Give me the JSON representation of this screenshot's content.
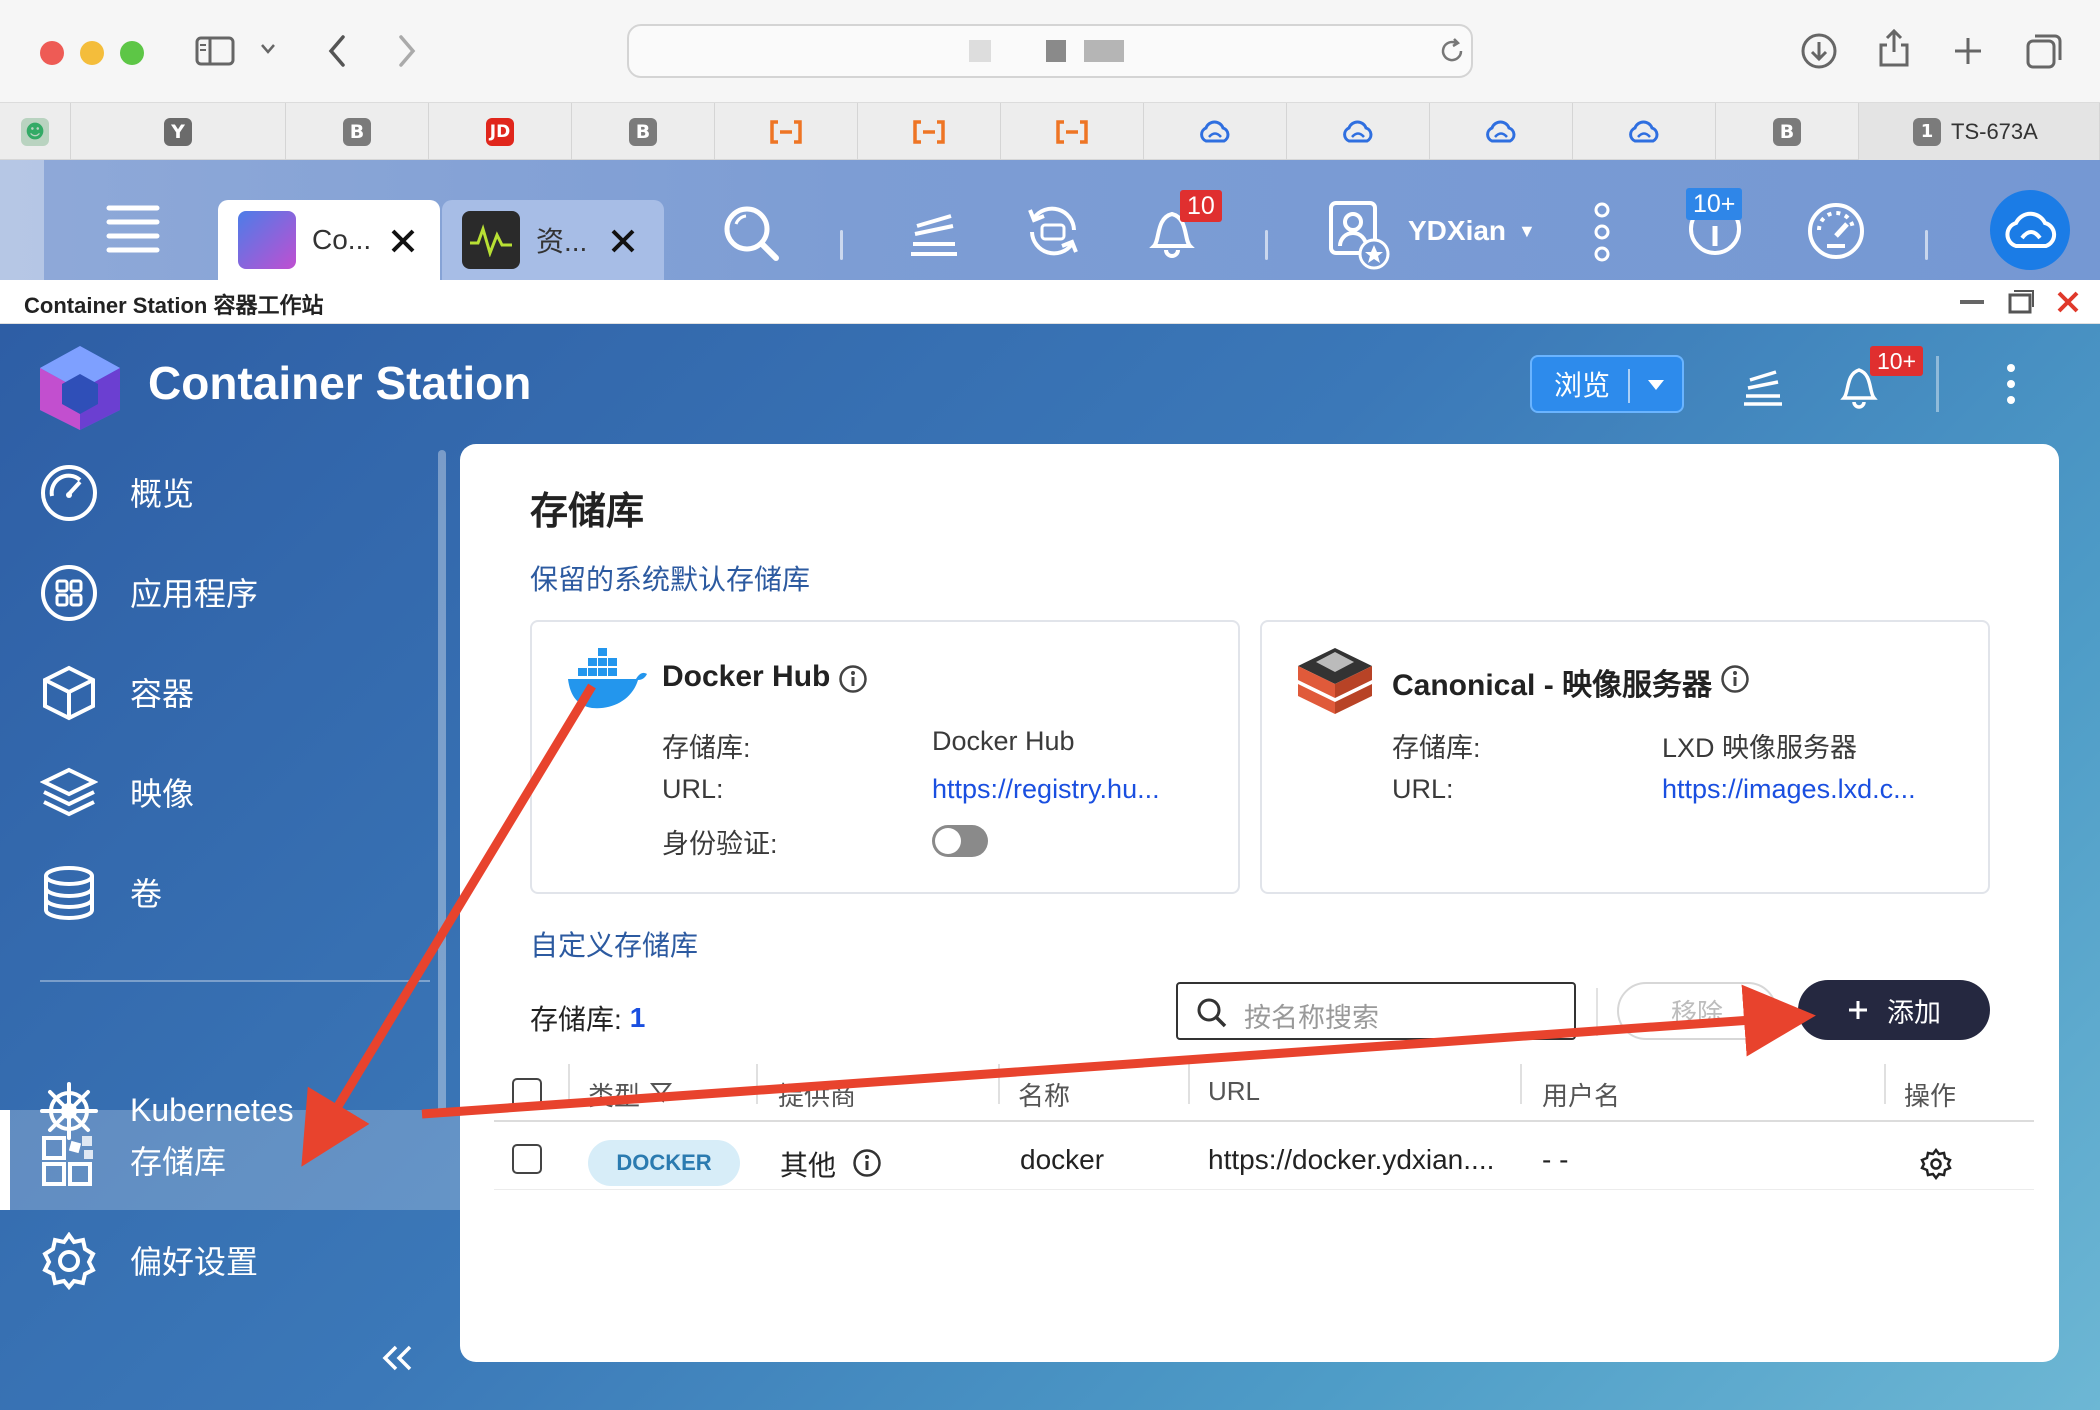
{
  "browser": {
    "favorites": [
      "",
      "Y",
      "B",
      "JD",
      "B",
      "",
      "",
      "",
      "",
      "",
      "",
      "",
      "B"
    ],
    "active_tab_badge": "1",
    "active_tab_label": "TS-673A",
    "colors": {
      "yahoo": "#6b6b6b",
      "bilibili": "#7b7b7b",
      "jd": "#e0261c",
      "orange": "#ee7524",
      "cloud": "#2f6fe0"
    }
  },
  "qts": {
    "tabs": [
      {
        "label": "Co...",
        "icon": "container-station-icon"
      },
      {
        "label": "资...",
        "icon": "resource-monitor-icon"
      }
    ],
    "notification_count": "10",
    "user": "YDXian",
    "update_badge": "10+"
  },
  "window": {
    "title": "Container Station 容器工作站"
  },
  "app": {
    "name": "Container Station",
    "browse_label": "浏览",
    "notification_badge": "10+"
  },
  "sidebar": {
    "items": [
      {
        "label": "概览",
        "icon": "dashboard-icon"
      },
      {
        "label": "应用程序",
        "icon": "apps-icon"
      },
      {
        "label": "容器",
        "icon": "container-cube-icon"
      },
      {
        "label": "映像",
        "icon": "layers-icon"
      },
      {
        "label": "卷",
        "icon": "database-icon"
      },
      {
        "label": "Kubernetes",
        "icon": "helm-wheel-icon"
      },
      {
        "label": "存储库",
        "icon": "repository-icon",
        "active": true
      },
      {
        "label": "偏好设置",
        "icon": "settings-icon"
      }
    ]
  },
  "page": {
    "title": "存储库",
    "reserved_heading": "保留的系统默认存储库",
    "cards": [
      {
        "name": "Docker Hub",
        "repo_label": "存储库:",
        "repo_value": "Docker Hub",
        "url_label": "URL:",
        "url_value": "https://registry.hu...",
        "auth_label": "身份验证:",
        "auth_enabled": false
      },
      {
        "name": "Canonical - 映像服务器",
        "repo_label": "存储库:",
        "repo_value": "LXD 映像服务器",
        "url_label": "URL:",
        "url_value": "https://images.lxd.c..."
      }
    ],
    "custom_heading": "自定义存储库",
    "count_label": "存储库:",
    "count_value": "1",
    "search_placeholder": "按名称搜索",
    "remove_label": "移除",
    "add_label": "添加",
    "table": {
      "headers": [
        "类型",
        "提供商",
        "名称",
        "URL",
        "用户名",
        "操作"
      ],
      "rows": [
        {
          "type": "DOCKER",
          "provider": "其他",
          "name": "docker",
          "url": "https://docker.ydxian....",
          "username": "- -"
        }
      ]
    }
  },
  "annotation_color": "#e8432d"
}
